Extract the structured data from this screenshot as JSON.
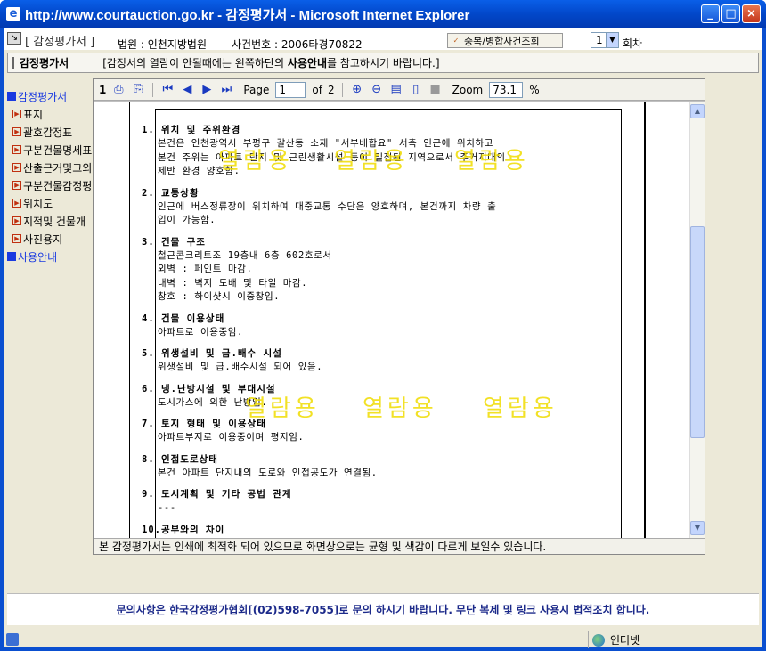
{
  "window": {
    "title": "http://www.courtauction.go.kr - 감정평가서 - Microsoft Internet Explorer",
    "buttons": {
      "minimize": "_",
      "maximize": "□",
      "close": "×"
    }
  },
  "header": {
    "section": "[ 감정평가서 ]",
    "court": "법원 : 인천지방법원",
    "case_no": "사건번호 : 2006타경70822",
    "dup_button": "중복/병합사건조회",
    "round_value": "1",
    "round_suffix": "회차"
  },
  "subheader": {
    "label": "감정평가서",
    "notice_pre": "[감정서의 열람이 안될때에는 왼쪽하단의 ",
    "notice_bold": "사용안내",
    "notice_post": "를 참고하시기 바랍니다.]"
  },
  "leftnav": {
    "items": [
      {
        "label": "감정평가서",
        "top": true
      },
      {
        "label": "표지"
      },
      {
        "label": "괄호감정표"
      },
      {
        "label": "구분건물명세표"
      },
      {
        "label": "산출근거및그외"
      },
      {
        "label": "구분건물감정평"
      },
      {
        "label": "위치도"
      },
      {
        "label": "지적및 건물개"
      },
      {
        "label": "사진용지"
      },
      {
        "label": "사용안내",
        "top": true
      }
    ]
  },
  "viewer": {
    "toolbar": {
      "page_indicator": "1",
      "page_label": "Page",
      "page_value": "1",
      "of_label": "of",
      "total_pages": "2",
      "zoom_label": "Zoom",
      "zoom_value": "73.1",
      "zoom_unit": "%"
    },
    "watermark": "열람용",
    "sections": [
      {
        "heading": "1. 위치 및 주위환경",
        "lines": [
          "본건은 인천광역시 부평구 갈산동 소재 \"서부배합요\" 서측 인근에 위치하고",
          "본건 주위는 아파트 단지 및 근린생활시설 등이 밀집된 지역으로서 주거지대의",
          "제반 환경 양호함."
        ]
      },
      {
        "heading": "2. 교통상황",
        "lines": [
          "인근에 버스정류장이 위치하여 대중교통 수단은 양호하며, 본건까지 차량 출",
          "입이 가능함."
        ]
      },
      {
        "heading": "3. 건물 구조",
        "lines": [
          "철근콘크리트조 19층내 6층 602호로서",
          "외벽 : 페인트 마감.",
          "내벽 : 벽지 도배 및 타일 마감.",
          "창호 : 하이샷시 이중창임."
        ]
      },
      {
        "heading": "4. 건물 이용상태",
        "lines": [
          "아파트로 이용중임."
        ]
      },
      {
        "heading": "5. 위생설비 및 급.배수 시설",
        "lines": [
          "위생설비 및 급.배수시설 되어 있음."
        ]
      },
      {
        "heading": "6. 냉.난방시설 및 부대시설",
        "lines": [
          "도시가스에 의한 난방임."
        ]
      },
      {
        "heading": "7. 토지 형태 및 이용상태",
        "lines": [
          "아파트부지로 이용중이며 평지임."
        ]
      },
      {
        "heading": "8. 인접도로상태",
        "lines": [
          "본건 아파트 단지내의 도로와 인접공도가 연결됨."
        ]
      },
      {
        "heading": "9. 도시계획 및 기타 공법 관계",
        "lines": [
          "---"
        ]
      },
      {
        "heading": "10.공부와의 차이",
        "lines": []
      }
    ],
    "footer": "본 감정평가서는 인쇄에 최적화 되어 있으므로 화면상으로는 균형 및 색감이 다르게 보일수 있습니다."
  },
  "infobar": "문의사항은 한국감정평가협회[(02)598-7055]로 문의 하시기 바랍니다. 무단 복제 및 링크 사용시 법적조치 합니다.",
  "statusbar": {
    "zone": "인터넷"
  }
}
